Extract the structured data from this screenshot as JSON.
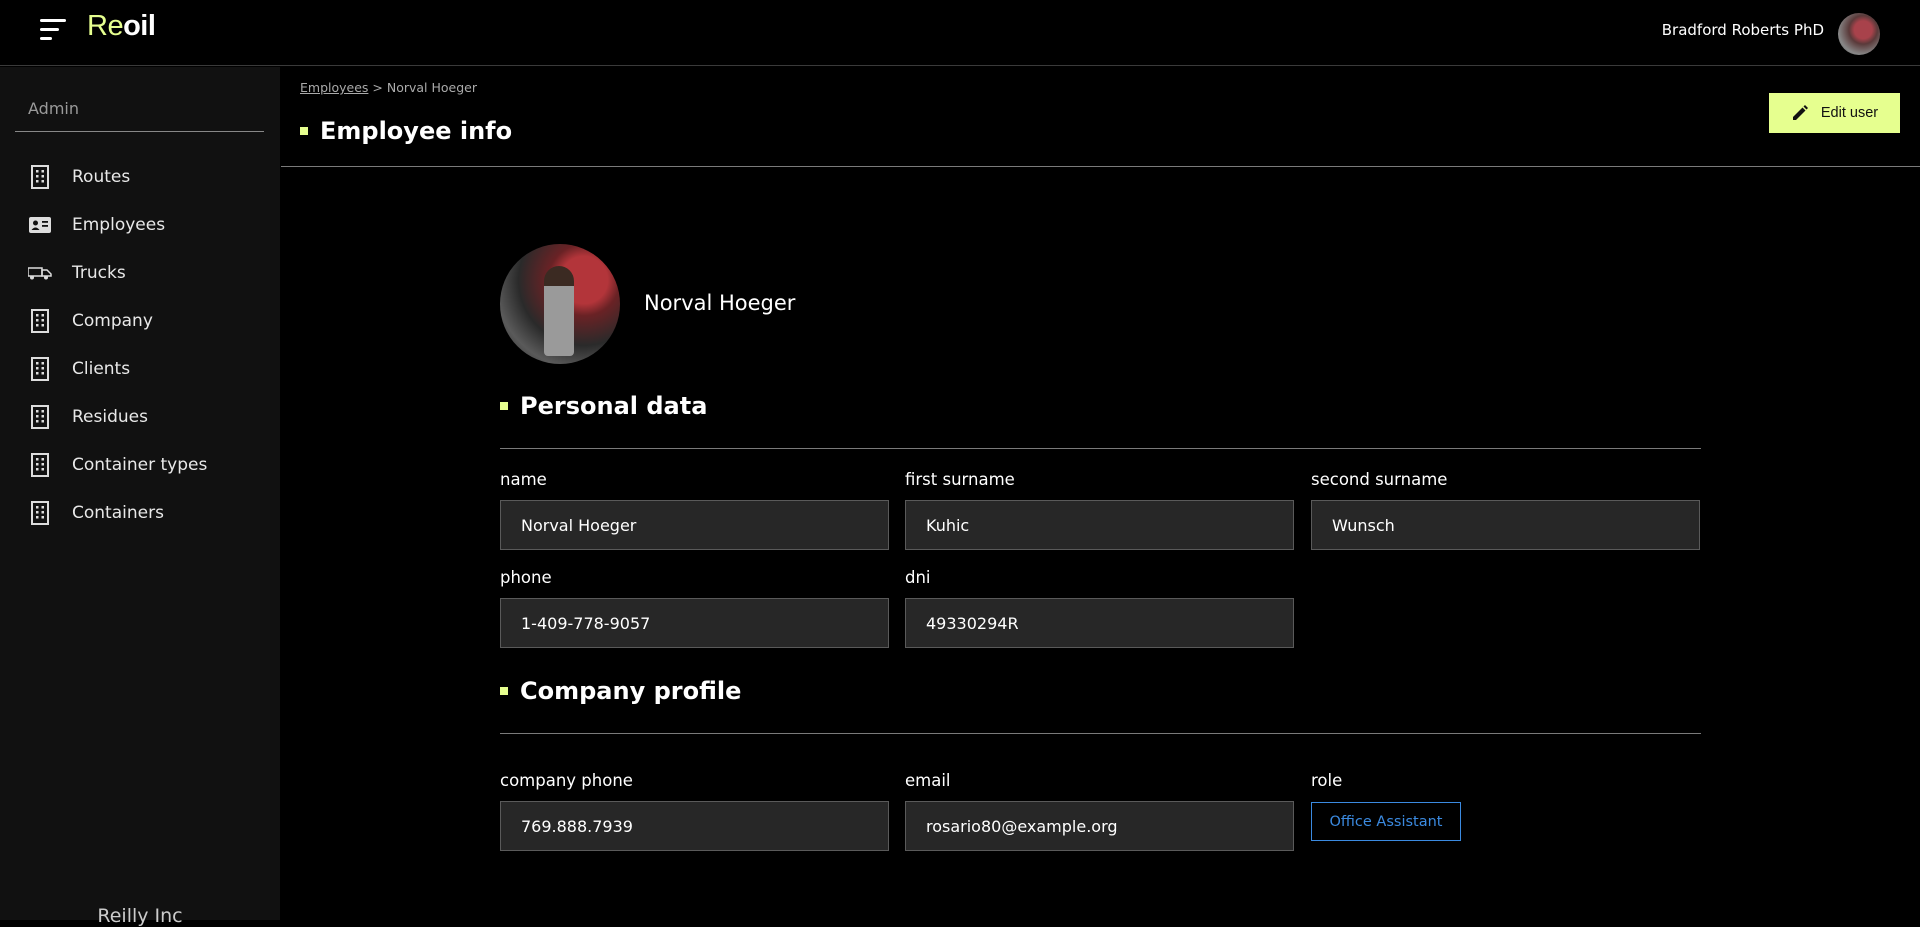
{
  "topbar": {
    "logo_re": "Re",
    "logo_oil": "oil",
    "user_name": "Bradford Roberts PhD"
  },
  "sidebar": {
    "admin_label": "Admin",
    "items": [
      {
        "label": "Routes",
        "icon": "building-icon"
      },
      {
        "label": "Employees",
        "icon": "id-card-icon"
      },
      {
        "label": "Trucks",
        "icon": "truck-icon"
      },
      {
        "label": "Company",
        "icon": "building-icon"
      },
      {
        "label": "Clients",
        "icon": "building-icon"
      },
      {
        "label": "Residues",
        "icon": "building-icon"
      },
      {
        "label": "Container types",
        "icon": "building-icon"
      },
      {
        "label": "Containers",
        "icon": "building-icon"
      }
    ],
    "footer": "Reilly Inc"
  },
  "main": {
    "breadcrumb": {
      "parent": "Employees",
      "separator": " > ",
      "current": "Norval Hoeger"
    },
    "title": "Employee info",
    "edit_button": "Edit user",
    "profile_name": "Norval Hoeger",
    "personal": {
      "title": "Personal data",
      "name_label": "name",
      "name_value": "Norval Hoeger",
      "first_surname_label": "first surname",
      "first_surname_value": "Kuhic",
      "second_surname_label": "second surname",
      "second_surname_value": "Wunsch",
      "phone_label": "phone",
      "phone_value": "1-409-778-9057",
      "dni_label": "dni",
      "dni_value": "49330294R"
    },
    "company": {
      "title": "Company profile",
      "company_phone_label": "company phone",
      "company_phone_value": "769.888.7939",
      "email_label": "email",
      "email_value": "rosario80@example.org",
      "role_label": "role",
      "role_value": "Office Assistant"
    }
  },
  "colors": {
    "accent": "#e6ff8f",
    "role_badge": "#3b8ae0"
  }
}
